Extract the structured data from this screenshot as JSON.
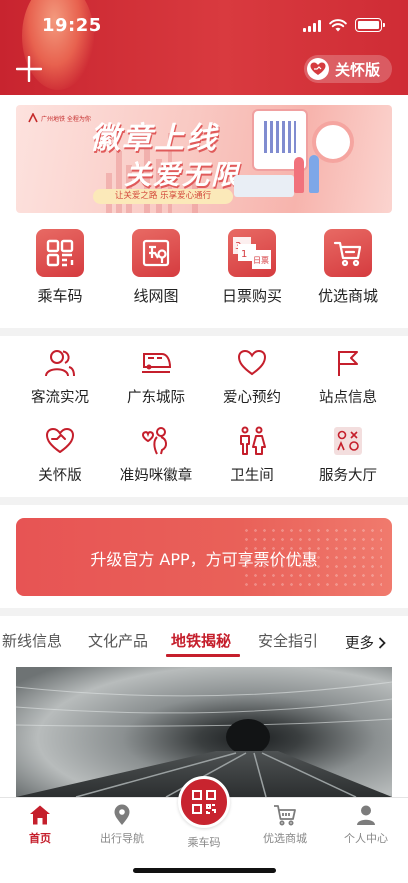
{
  "status_bar": {
    "time": "19:25"
  },
  "header": {
    "care_mode_label": "关怀版"
  },
  "banner": {
    "headline_1": "徽章上线",
    "headline_2": "关爱无限",
    "tagline": "让关爱之路 乐享爱心通行",
    "logo_text": "广州地铁 全程为你"
  },
  "quick_actions": [
    {
      "label": "乘车码",
      "icon": "qr-code-icon"
    },
    {
      "label": "线网图",
      "icon": "route-map-icon"
    },
    {
      "label": "日票购买",
      "icon": "day-ticket-icon",
      "icon_text": "日票"
    },
    {
      "label": "优选商城",
      "icon": "shopping-cart-icon"
    }
  ],
  "services": [
    {
      "label": "客流实况",
      "icon": "passenger-flow-icon"
    },
    {
      "label": "广东城际",
      "icon": "intercity-train-icon"
    },
    {
      "label": "爱心预约",
      "icon": "heart-icon"
    },
    {
      "label": "站点信息",
      "icon": "station-flag-icon"
    },
    {
      "label": "关怀版",
      "icon": "care-hands-icon"
    },
    {
      "label": "准妈咪徽章",
      "icon": "mom-badge-icon"
    },
    {
      "label": "卫生间",
      "icon": "restroom-icon"
    },
    {
      "label": "服务大厅",
      "icon": "service-hall-icon"
    }
  ],
  "upgrade_banner": {
    "text": "升级官方 APP，方可享票价优惠"
  },
  "news_tabs": {
    "items": [
      "新线信息",
      "文化产品",
      "地铁揭秘",
      "安全指引"
    ],
    "active": "地铁揭秘",
    "more_label": "更多"
  },
  "tab_bar": {
    "items": [
      {
        "label": "首页",
        "icon": "home-icon",
        "active": true
      },
      {
        "label": "出行导航",
        "icon": "location-pin-icon",
        "active": false
      },
      {
        "label": "乘车码",
        "icon": "qr-code-icon",
        "active": false
      },
      {
        "label": "优选商城",
        "icon": "shopping-cart-icon",
        "active": false
      },
      {
        "label": "个人中心",
        "icon": "user-icon",
        "active": false
      }
    ]
  },
  "colors": {
    "brand_red": "#c8242f",
    "accent_red": "#c51f2c",
    "icon_red": "#d53b3f"
  }
}
